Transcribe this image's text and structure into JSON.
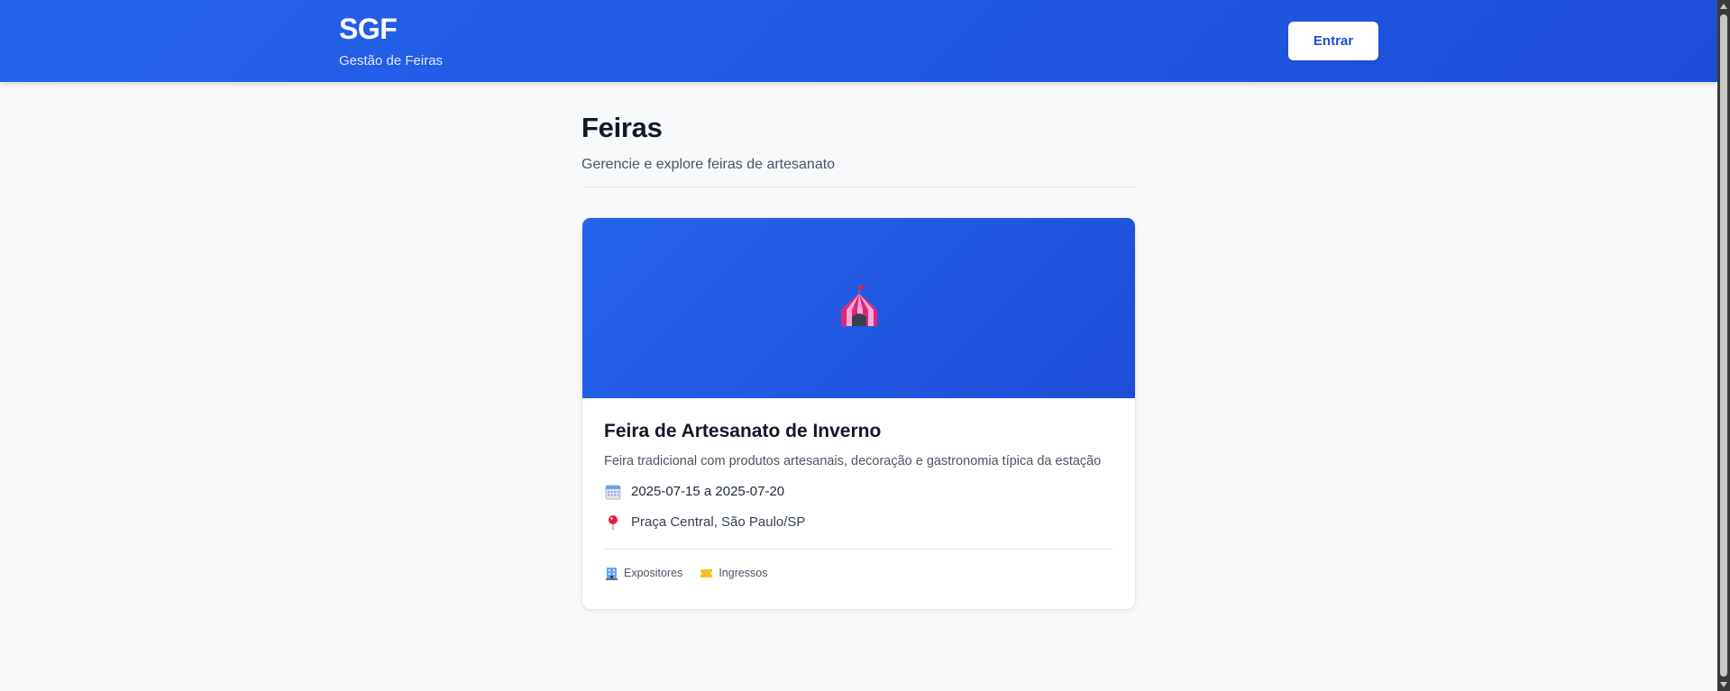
{
  "header": {
    "brand_title": "SGF",
    "brand_subtitle": "Gestão de Feiras",
    "login_label": "Entrar"
  },
  "page": {
    "title": "Feiras",
    "subtitle": "Gerencie e explore feiras de artesanato"
  },
  "fairs": [
    {
      "banner_icon": "circus-tent-icon",
      "title": "Feira de Artesanato de Inverno",
      "description": "Feira tradicional com produtos artesanais, decoração e gastronomia típica da estação",
      "dates": "2025-07-15 a 2025-07-20",
      "location": "Praça Central, São Paulo/SP",
      "footer": [
        {
          "icon": "building-icon",
          "label": "Expositores"
        },
        {
          "icon": "ticket-icon",
          "label": "Ingressos"
        }
      ]
    }
  ],
  "colors": {
    "brand": "#2563eb",
    "brand_dark": "#1d4ed8",
    "background": "#f7f9fb"
  }
}
